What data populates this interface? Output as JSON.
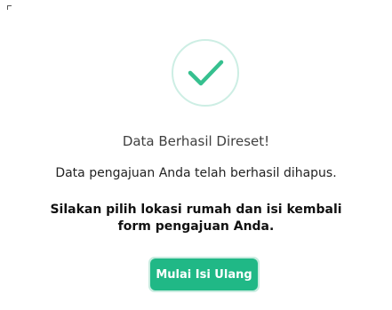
{
  "dialog": {
    "title": "Data Berhasil Direset!",
    "message": "Data pengajuan Anda telah berhasil dihapus.",
    "instruction": "Silakan pilih lokasi rumah dan isi kembali form pengajuan Anda.",
    "button_label": "Mulai Isi Ulang",
    "icon": "check-icon"
  },
  "colors": {
    "accent": "#20b886",
    "ring": "#cdeee4",
    "check": "#36c08f"
  }
}
